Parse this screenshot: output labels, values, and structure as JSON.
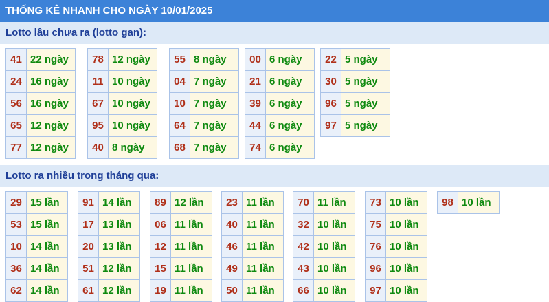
{
  "title": "THỐNG KÊ NHANH CHO NGÀY 10/01/2025",
  "section1": {
    "heading": "Lotto lâu chưa ra (lotto gan):",
    "groups": [
      [
        [
          "41",
          "22 ngày"
        ],
        [
          "24",
          "16 ngày"
        ],
        [
          "56",
          "16 ngày"
        ],
        [
          "65",
          "12 ngày"
        ],
        [
          "77",
          "12 ngày"
        ]
      ],
      [
        [
          "78",
          "12 ngày"
        ],
        [
          "11",
          "10 ngày"
        ],
        [
          "67",
          "10 ngày"
        ],
        [
          "95",
          "10 ngày"
        ],
        [
          "40",
          "8 ngày"
        ]
      ],
      [
        [
          "55",
          "8 ngày"
        ],
        [
          "04",
          "7 ngày"
        ],
        [
          "10",
          "7 ngày"
        ],
        [
          "64",
          "7 ngày"
        ],
        [
          "68",
          "7 ngày"
        ]
      ],
      [
        [
          "00",
          "6 ngày"
        ],
        [
          "21",
          "6 ngày"
        ],
        [
          "39",
          "6 ngày"
        ],
        [
          "44",
          "6 ngày"
        ],
        [
          "74",
          "6 ngày"
        ]
      ],
      [
        [
          "22",
          "5 ngày"
        ],
        [
          "30",
          "5 ngày"
        ],
        [
          "96",
          "5 ngày"
        ],
        [
          "97",
          "5 ngày"
        ]
      ]
    ]
  },
  "section2": {
    "heading": "Lotto ra nhiều trong tháng qua:",
    "groups": [
      [
        [
          "29",
          "15 lần"
        ],
        [
          "53",
          "15 lần"
        ],
        [
          "10",
          "14 lần"
        ],
        [
          "36",
          "14 lần"
        ],
        [
          "62",
          "14 lần"
        ]
      ],
      [
        [
          "91",
          "14 lần"
        ],
        [
          "17",
          "13 lần"
        ],
        [
          "20",
          "13 lần"
        ],
        [
          "51",
          "12 lần"
        ],
        [
          "61",
          "12 lần"
        ]
      ],
      [
        [
          "89",
          "12 lần"
        ],
        [
          "06",
          "11 lần"
        ],
        [
          "12",
          "11 lần"
        ],
        [
          "15",
          "11 lần"
        ],
        [
          "19",
          "11 lần"
        ]
      ],
      [
        [
          "23",
          "11 lần"
        ],
        [
          "40",
          "11 lần"
        ],
        [
          "46",
          "11 lần"
        ],
        [
          "49",
          "11 lần"
        ],
        [
          "50",
          "11 lần"
        ]
      ],
      [
        [
          "70",
          "11 lần"
        ],
        [
          "32",
          "10 lần"
        ],
        [
          "42",
          "10 lần"
        ],
        [
          "43",
          "10 lần"
        ],
        [
          "66",
          "10 lần"
        ]
      ],
      [
        [
          "73",
          "10 lần"
        ],
        [
          "75",
          "10 lần"
        ],
        [
          "76",
          "10 lần"
        ],
        [
          "96",
          "10 lần"
        ],
        [
          "97",
          "10 lần"
        ]
      ],
      [
        [
          "98",
          "10 lần"
        ]
      ]
    ]
  }
}
